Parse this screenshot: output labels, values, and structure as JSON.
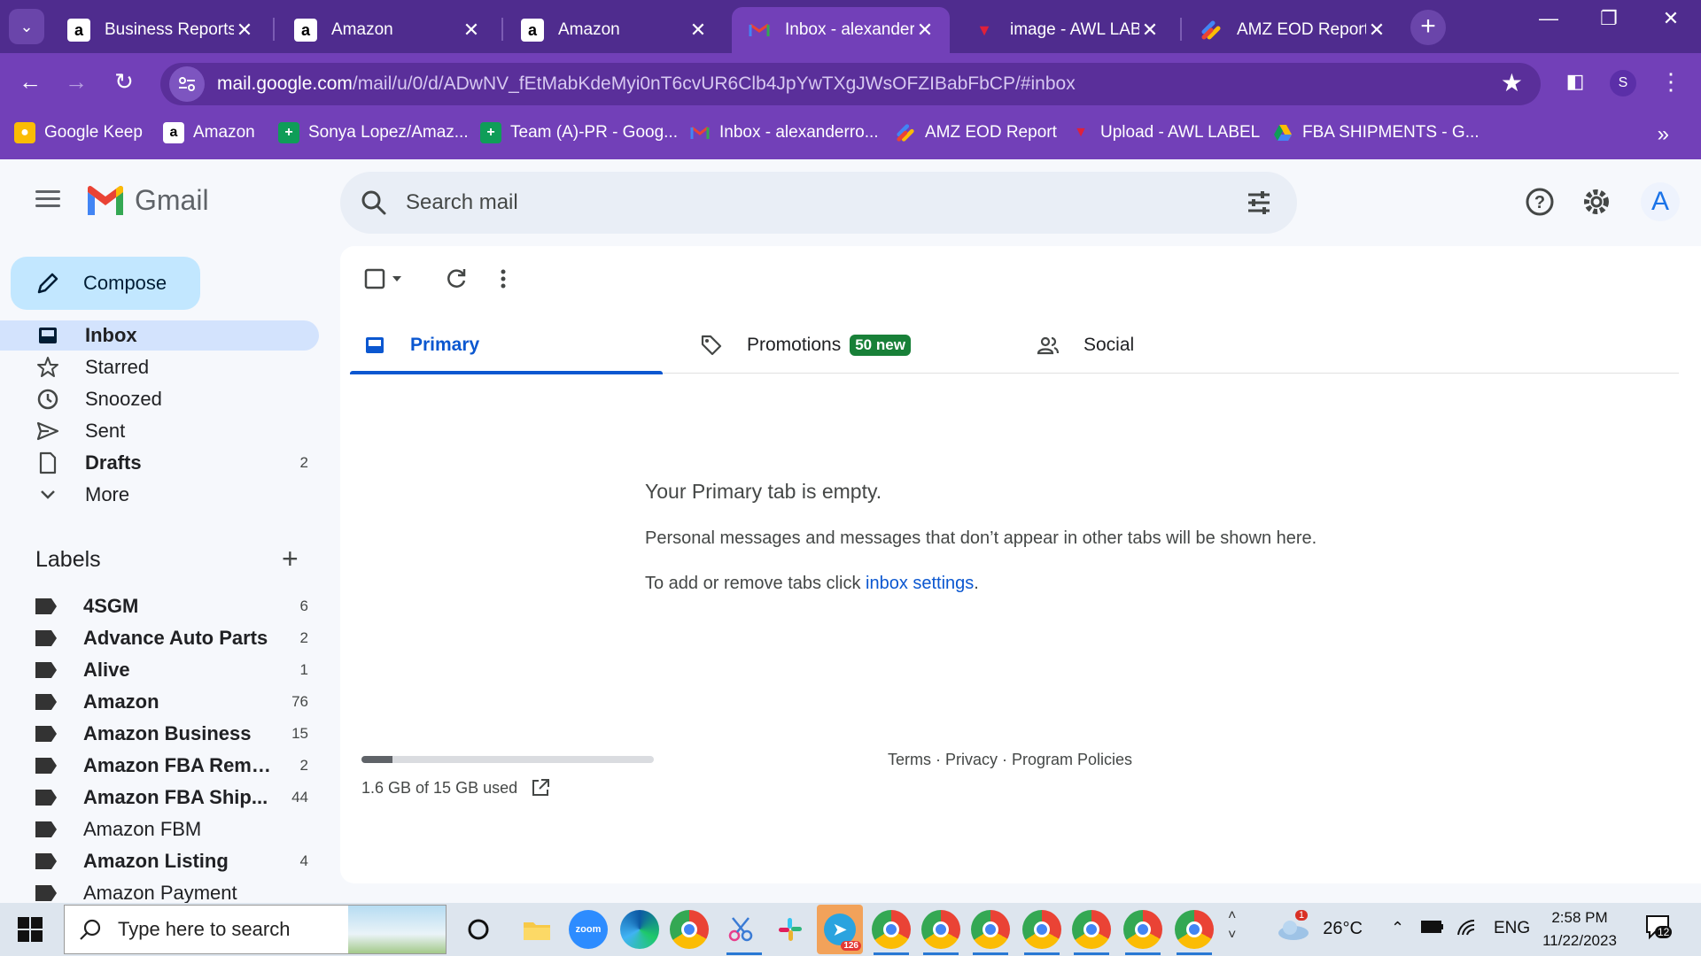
{
  "browser": {
    "tabs": [
      {
        "label": "Business Reports",
        "icon": "amazon-icon"
      },
      {
        "label": "Amazon",
        "icon": "amazon-icon"
      },
      {
        "label": "Amazon",
        "icon": "amazon-icon"
      },
      {
        "label": "Inbox - alexanderro",
        "icon": "gmail-icon",
        "active": true
      },
      {
        "label": "image - AWL LABE",
        "icon": "awl-icon"
      },
      {
        "label": "AMZ EOD Report",
        "icon": "script-icon"
      }
    ],
    "url_host": "mail.google.com",
    "url_path": "/mail/u/0/d/ADwNV_fEtMabKdeMyi0nT6cvUR6Clb4JpYwTXgJWsOFZIBabFbCP/#inbox",
    "profile_initial": "S",
    "bookmarks": [
      {
        "label": "Google Keep",
        "icon": "keep-icon"
      },
      {
        "label": "Amazon",
        "icon": "amazon-icon"
      },
      {
        "label": "Sonya Lopez/Amaz...",
        "icon": "sheets-icon"
      },
      {
        "label": "Team (A)-PR - Goog...",
        "icon": "sheets-icon"
      },
      {
        "label": "Inbox - alexanderro...",
        "icon": "gmail-icon"
      },
      {
        "label": "AMZ EOD Report",
        "icon": "script-icon"
      },
      {
        "label": "Upload - AWL LABEL",
        "icon": "awl-icon"
      },
      {
        "label": "FBA SHIPMENTS - G...",
        "icon": "drive-icon"
      }
    ]
  },
  "gmail": {
    "brand": "Gmail",
    "search_placeholder": "Search mail",
    "account_initial": "A",
    "compose_label": "Compose",
    "nav": [
      {
        "label": "Inbox",
        "count": "",
        "icon": "inbox-icon",
        "active": true
      },
      {
        "label": "Starred",
        "count": "",
        "icon": "star-icon"
      },
      {
        "label": "Snoozed",
        "count": "",
        "icon": "clock-icon"
      },
      {
        "label": "Sent",
        "count": "",
        "icon": "send-icon"
      },
      {
        "label": "Drafts",
        "count": "2",
        "icon": "draft-icon",
        "bold": true
      },
      {
        "label": "More",
        "count": "",
        "icon": "chevron-down-icon"
      }
    ],
    "labels_title": "Labels",
    "labels": [
      {
        "name": "4SGM",
        "count": "6",
        "bold": true
      },
      {
        "name": "Advance Auto Parts",
        "count": "2",
        "bold": true
      },
      {
        "name": "Alive",
        "count": "1",
        "bold": true
      },
      {
        "name": "Amazon",
        "count": "76",
        "bold": true
      },
      {
        "name": "Amazon Business",
        "count": "15",
        "bold": true
      },
      {
        "name": "Amazon FBA Remo...",
        "count": "2",
        "bold": true
      },
      {
        "name": "Amazon FBA Ship...",
        "count": "44",
        "bold": true
      },
      {
        "name": "Amazon FBM",
        "count": "",
        "bold": false
      },
      {
        "name": "Amazon Listing",
        "count": "4",
        "bold": true
      },
      {
        "name": "Amazon Payment",
        "count": "",
        "bold": false
      }
    ],
    "tabs": [
      {
        "label": "Primary",
        "icon": "inbox-icon",
        "active": true
      },
      {
        "label": "Promotions",
        "icon": "tag-icon",
        "badge": "50 new"
      },
      {
        "label": "Social",
        "icon": "people-icon"
      }
    ],
    "empty": {
      "title": "Your Primary tab is empty.",
      "line1": "Personal messages and messages that don’t appear in other tabs will be shown here.",
      "line2_prefix": "To add or remove tabs click ",
      "line2_link": "inbox settings",
      "line2_suffix": "."
    },
    "storage": {
      "text": "1.6 GB of 15 GB used",
      "used_fraction": 0.107
    },
    "footer": {
      "terms": "Terms",
      "privacy": "Privacy",
      "policies": "Program Policies",
      "sep": " · "
    }
  },
  "taskbar": {
    "search_placeholder": "Type here to search",
    "weather": "26°C",
    "weather_badge": "1",
    "language": "ENG",
    "time": "2:58 PM",
    "date": "11/22/2023",
    "notifications": "12",
    "telegram_badge": "126",
    "zoom_label": "zoom"
  }
}
